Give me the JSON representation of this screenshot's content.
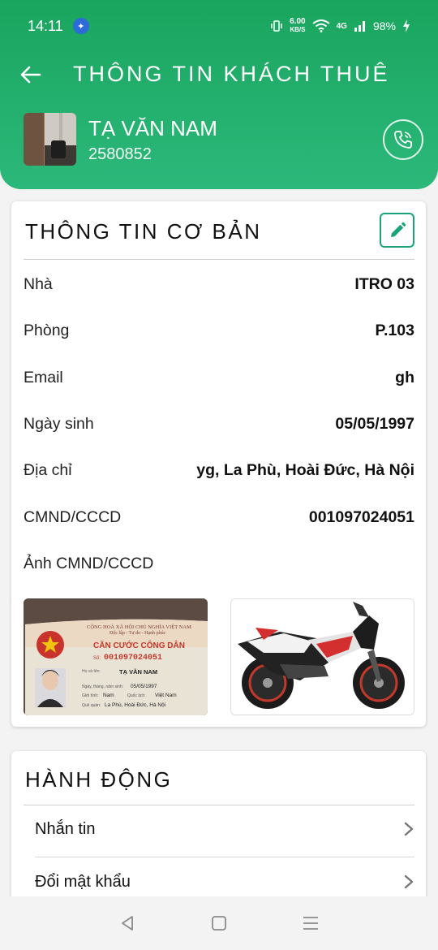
{
  "status_bar": {
    "time": "14:11",
    "speed_top": "6.00",
    "speed_bottom": "KB/S",
    "network": "4G",
    "battery": "98%"
  },
  "header": {
    "title": "THÔNG TIN KHÁCH THUÊ",
    "tenant_name": "TẠ VĂN NAM",
    "tenant_code": "2580852"
  },
  "basic_info": {
    "title": "THÔNG TIN CƠ BẢN",
    "rows": [
      {
        "label": "Nhà",
        "value": "ITRO 03"
      },
      {
        "label": "Phòng",
        "value": "P.103"
      },
      {
        "label": "Email",
        "value": "gh"
      },
      {
        "label": "Ngày sinh",
        "value": "05/05/1997"
      },
      {
        "label": "Địa chỉ",
        "value": "yg, La Phù, Hoài Đức, Hà Nội"
      },
      {
        "label": "CMND/CCCD",
        "value": "001097024051"
      }
    ],
    "photos_label": "Ảnh CMND/CCCD",
    "id_card": {
      "country_line": "CỘNG HOÀ XÃ HỘI CHỦ NGHĨA VIỆT NAM",
      "motto": "Độc lập - Tự do - Hạnh phúc",
      "card_type": "CĂN CƯỚC CÔNG DÂN",
      "number_prefix": "Số:",
      "number": "001097024051",
      "name_label": "Họ và tên:",
      "name": "TẠ VĂN NAM",
      "dob_label": "Ngày, tháng, năm sinh:",
      "dob": "05/05/1997",
      "sex_label": "Giới tính:",
      "sex": "Nam",
      "nationality_label": "Quốc tịch:",
      "nationality": "Việt Nam",
      "hometown_label": "Quê quán:",
      "hometown": "La Phù, Hoài Đức, Hà Nội"
    }
  },
  "actions": {
    "title": "HÀNH ĐỘNG",
    "items": [
      {
        "label": "Nhắn tin"
      },
      {
        "label": "Đổi mật khẩu"
      }
    ]
  },
  "colors": {
    "primary_green": "#1aa55e",
    "accent_teal": "#1aa37a"
  }
}
